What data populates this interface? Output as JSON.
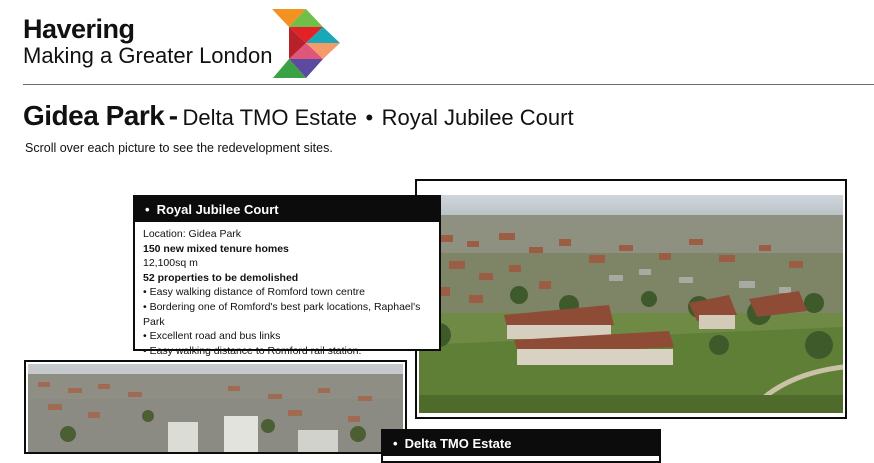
{
  "header": {
    "brand_name": "Havering",
    "brand_tagline": "Making a Greater London"
  },
  "page": {
    "title_main": "Gidea Park",
    "title_separator": "-",
    "title_part1": "Delta TMO Estate",
    "title_dot": "•",
    "title_part2": "Royal Jubilee Court",
    "instruction": "Scroll over each picture to see the redevelopment sites."
  },
  "cards": [
    {
      "heading": "Royal Jubilee Court",
      "bullet": "•",
      "location": "Location: Gidea Park",
      "homes": "150 new mixed tenure homes",
      "area": "12,100sq m",
      "demolished": "52 properties to be demolished",
      "features": [
        "• Easy walking distance of Romford town centre",
        "• Bordering one of Romford's best park locations, Raphael's Park",
        "• Excellent road and bus links",
        "• Easy walking distance to Romford rail station."
      ]
    },
    {
      "heading": "Delta TMO Estate",
      "bullet": "•"
    }
  ],
  "images": {
    "photo1": "aerial-photo-royal-jubilee-court",
    "photo2": "aerial-photo-delta-tmo-estate"
  },
  "colors": {
    "logo_orange": "#f39220",
    "logo_green": "#6fbf4a",
    "logo_red": "#e32228",
    "logo_teal": "#1aa7b8",
    "logo_blue": "#52aee0",
    "logo_peach": "#f59a6a",
    "logo_pink": "#e0557a",
    "logo_purple": "#5b4a9e",
    "logo_darkgreen": "#3aa245"
  }
}
